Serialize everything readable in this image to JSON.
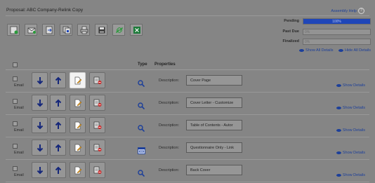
{
  "page": {
    "title": "Proposal: ABC Company-Relink Copy",
    "help_link": "Assembly Help",
    "help_glyph": "?"
  },
  "toolbar": {
    "buttons": [
      {
        "icon": "add-document-icon"
      },
      {
        "icon": "email-icon"
      },
      {
        "icon": "document-export-icon"
      },
      {
        "icon": "document-copy-icon"
      },
      {
        "icon": "print-icon"
      },
      {
        "icon": "save-icon"
      },
      {
        "icon": "link-icon"
      },
      {
        "icon": "excel-icon"
      }
    ]
  },
  "status": {
    "pending": {
      "label": "Pending",
      "value": "100%",
      "percent": 100
    },
    "past_due": {
      "label": "Past Due",
      "value": "0%",
      "percent": 0
    },
    "finalized": {
      "label": "Finalized",
      "value": "0%",
      "percent": 0
    },
    "accent": "#1f46b8"
  },
  "links": {
    "show_all": "Show All Details",
    "hide_all": "Hide All Details"
  },
  "table": {
    "col_type": "Type",
    "col_properties": "Properties",
    "rows": [
      {
        "email": "Email",
        "desc_label": "Description:",
        "description": "Cover Page",
        "type_icon": "search-icon",
        "details": "Show Details"
      },
      {
        "email": "Email",
        "desc_label": "Description:",
        "description": "Cover Letter - Customize",
        "type_icon": "search-icon",
        "details": "Show Details"
      },
      {
        "email": "Email",
        "desc_label": "Description:",
        "description": "Table of Contents - Autor",
        "type_icon": "search-icon",
        "details": "Show Details"
      },
      {
        "email": "Email",
        "desc_label": "Description:",
        "description": "Questionnaire Only - Link",
        "type_icon": "form-icon",
        "details": "Show Details"
      },
      {
        "email": "Email",
        "desc_label": "Description:",
        "description": "Back Cover",
        "type_icon": "search-icon",
        "details": "Show Details"
      }
    ]
  }
}
